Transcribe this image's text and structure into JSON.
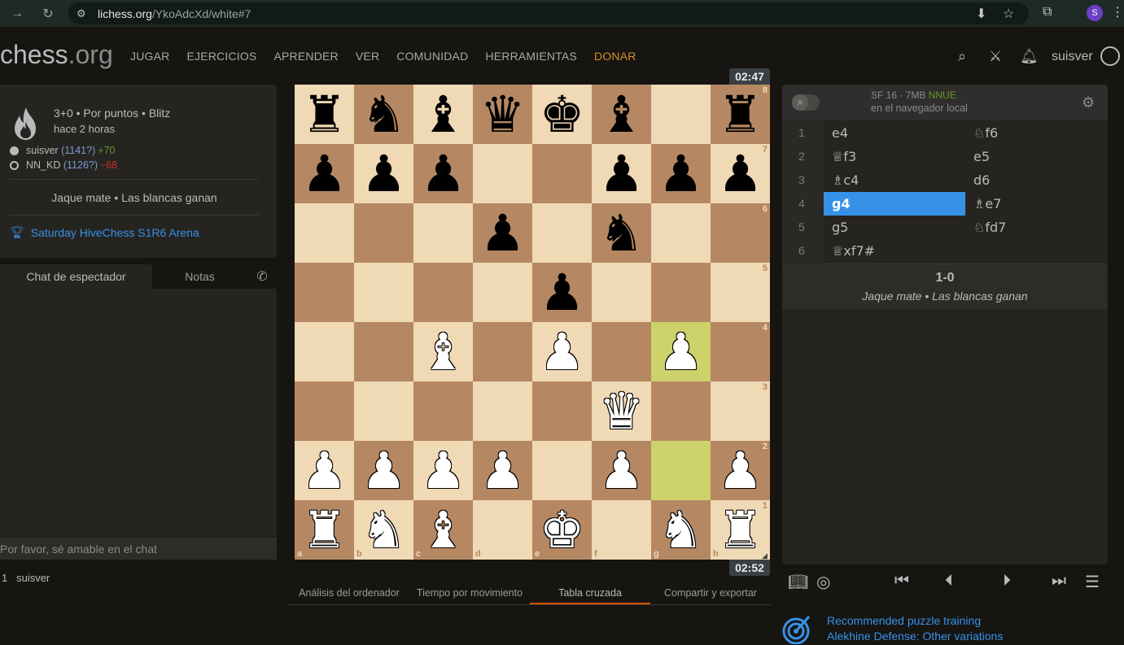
{
  "browser": {
    "url_host": "lichess.org",
    "url_path": "/YkoAdcXd/white#7",
    "profile_initial": "S"
  },
  "header": {
    "logo_main": "chess",
    "logo_tld": ".org",
    "nav": [
      "JUGAR",
      "EJERCICIOS",
      "APRENDER",
      "VER",
      "COMUNIDAD",
      "HERRAMIENTAS"
    ],
    "donate": "DONAR",
    "username": "suisver"
  },
  "game_info": {
    "title": "3+0 • Por puntos • Blitz",
    "time_ago": "hace 2 horas",
    "white_name": "suisver",
    "white_rating": "(1141?)",
    "white_diff": "+70",
    "black_name": "NN_KD",
    "black_rating": "(1126?)",
    "black_diff": "−68",
    "result": "Jaque mate • Las blancas ganan",
    "tournament": "Saturday HiveChess S1R6 Arena"
  },
  "chat": {
    "tab_spectator": "Chat de espectador",
    "tab_notes": "Notas",
    "placeholder": "Por favor, sé amable en el chat",
    "watchers_count": "1",
    "watcher": "suisver"
  },
  "clocks": {
    "top": "02:47",
    "bottom": "02:52"
  },
  "board": {
    "ranks": [
      "8",
      "7",
      "6",
      "5",
      "4",
      "3",
      "2",
      "1"
    ],
    "files": [
      "a",
      "b",
      "c",
      "d",
      "e",
      "f",
      "g",
      "h"
    ],
    "position": [
      [
        "br",
        "bn",
        "bb",
        "bq",
        "bk",
        "bb",
        "",
        "br"
      ],
      [
        "bp",
        "bp",
        "bp",
        "",
        "",
        "bp",
        "bp",
        "bp"
      ],
      [
        "",
        "",
        "",
        "bp",
        "",
        "bn",
        "",
        ""
      ],
      [
        "",
        "",
        "",
        "",
        "bp",
        "",
        "",
        ""
      ],
      [
        "",
        "",
        "wb",
        "",
        "wp",
        "",
        "wp",
        ""
      ],
      [
        "",
        "",
        "",
        "",
        "",
        "wq",
        "",
        ""
      ],
      [
        "wp",
        "wp",
        "wp",
        "wp",
        "",
        "wp",
        "",
        "wp"
      ],
      [
        "wr",
        "wn",
        "wb",
        "",
        "wk",
        "",
        "wn",
        "wr"
      ]
    ],
    "highlighted": [
      "g4",
      "g2"
    ]
  },
  "under_tabs": [
    "Análisis del ordenador",
    "Tiempo por movimiento",
    "Tabla cruzada",
    "Compartir y exportar"
  ],
  "under_tab_active": 2,
  "engine": {
    "name": "SF 16 · 7MB",
    "nnue": "NNUE",
    "location": "en el navegador local"
  },
  "moves": [
    {
      "num": "1",
      "white": "e4",
      "black": "♘f6"
    },
    {
      "num": "2",
      "white": "♕f3",
      "black": "e5"
    },
    {
      "num": "3",
      "white": "♗c4",
      "black": "d6"
    },
    {
      "num": "4",
      "white": "g4",
      "black": "♗e7"
    },
    {
      "num": "5",
      "white": "g5",
      "black": "♘fd7"
    },
    {
      "num": "6",
      "white": "♕xf7#",
      "black": ""
    }
  ],
  "active_move": "4w",
  "result": {
    "score": "1-0",
    "text": "Jaque mate • Las blancas ganan"
  },
  "puzzle": {
    "line1": "Recommended puzzle training",
    "line2": "Alekhine Defense: Other variations"
  },
  "colors": {
    "accent_blue": "#3692e7",
    "donate_orange": "#d59120",
    "light_square": "#f0d9b5",
    "dark_square": "#b58863",
    "highlight": "#cdd26a"
  }
}
